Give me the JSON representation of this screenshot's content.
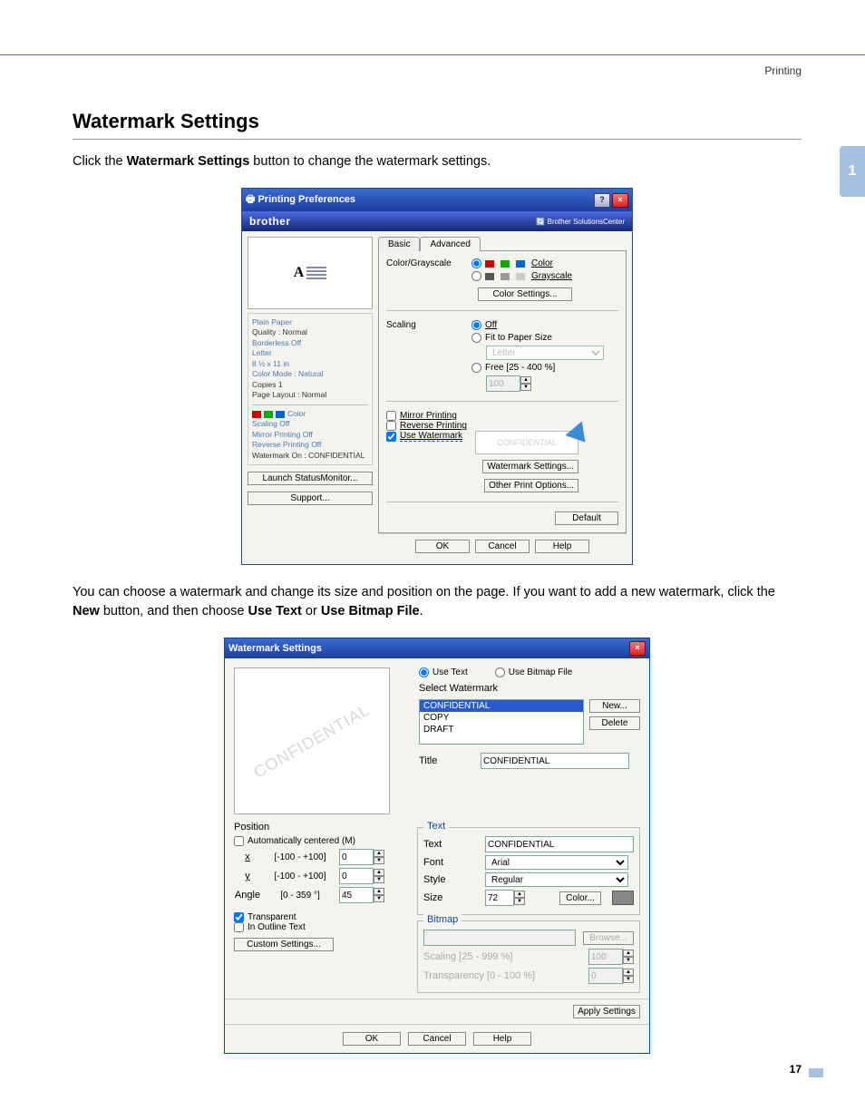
{
  "header": {
    "category": "Printing",
    "side_tab": "1",
    "page_number": "17"
  },
  "section": {
    "title": "Watermark Settings",
    "intro_1a": "Click the ",
    "intro_1b": "Watermark Settings",
    "intro_1c": " button to change the watermark settings.",
    "mid_a": "You can choose a watermark and change its size and position on the page. If you want to add a new watermark, click the ",
    "mid_b": "New",
    "mid_c": " button, and then choose ",
    "mid_d": "Use Text",
    "mid_e": " or ",
    "mid_f": "Use Bitmap File",
    "mid_g": "."
  },
  "dlg1": {
    "title": "Printing Preferences",
    "brand": "brother",
    "brand_sc": "Brother SolutionsCenter",
    "settings": {
      "paper": "Plain Paper",
      "quality": "Quality : Normal",
      "borderless": "Borderless Off",
      "size": "Letter",
      "dim": "8 ½ x 11 in",
      "colormode": "Color Mode : Natural",
      "copies": "Copies 1",
      "layout": "Page Layout : Normal",
      "color": "Color",
      "scaling": "Scaling Off",
      "mirror": "Mirror Printing Off",
      "reverse": "Reverse Printing Off",
      "watermark": "Watermark On : CONFIDENTIAL"
    },
    "left_btn_1": "Launch StatusMonitor...",
    "left_btn_2": "Support...",
    "tabs": {
      "basic": "Basic",
      "advanced": "Advanced"
    },
    "labels": {
      "colorgs": "Color/Grayscale",
      "color": "Color",
      "grayscale": "Grayscale",
      "color_settings": "Color Settings...",
      "scaling": "Scaling",
      "off": "Off",
      "fit": "Fit to Paper Size",
      "fit_sel": "Letter",
      "free": "Free [25 - 400 %]",
      "free_val": "100",
      "mirror": "Mirror Printing",
      "reverse": "Reverse Printing",
      "usewm": "Use Watermark",
      "wm_sample": "CONFIDENTIAL",
      "wm_settings": "Watermark Settings...",
      "other": "Other Print Options...",
      "default": "Default"
    },
    "footer": {
      "ok": "OK",
      "cancel": "Cancel",
      "help": "Help"
    }
  },
  "dlg2": {
    "title": "Watermark Settings",
    "preview_wm": "CONFIDENTIAL",
    "use_text": "Use Text",
    "use_bitmap": "Use Bitmap File",
    "select_wm": "Select Watermark",
    "list": {
      "a": "CONFIDENTIAL",
      "b": "COPY",
      "c": "DRAFT"
    },
    "new_btn": "New...",
    "delete_btn": "Delete",
    "title_lbl": "Title",
    "title_val": "CONFIDENTIAL",
    "text_group": "Text",
    "text_lbl": "Text",
    "text_val": "CONFIDENTIAL",
    "font_lbl": "Font",
    "font_val": "Arial",
    "style_lbl": "Style",
    "style_val": "Regular",
    "size_lbl": "Size",
    "size_val": "72",
    "color_btn": "Color...",
    "bitmap_group": "Bitmap",
    "browse": "Browse...",
    "scaling_lbl": "Scaling [25 - 999 %]",
    "scaling_val": "100",
    "transp_lbl": "Transparency [0 - 100 %]",
    "transp_val": "0",
    "position": "Position",
    "auto_center": "Automatically centered (M)",
    "x_lbl": "x",
    "y_lbl": "y",
    "xy_range": "[-100 - +100]",
    "x_val": "0",
    "y_val": "0",
    "angle_lbl": "Angle",
    "angle_range": "[0 - 359 °]",
    "angle_val": "45",
    "transparent": "Transparent",
    "outline": "In Outline Text",
    "custom": "Custom Settings...",
    "apply": "Apply Settings",
    "ok": "OK",
    "cancel": "Cancel",
    "help": "Help"
  }
}
